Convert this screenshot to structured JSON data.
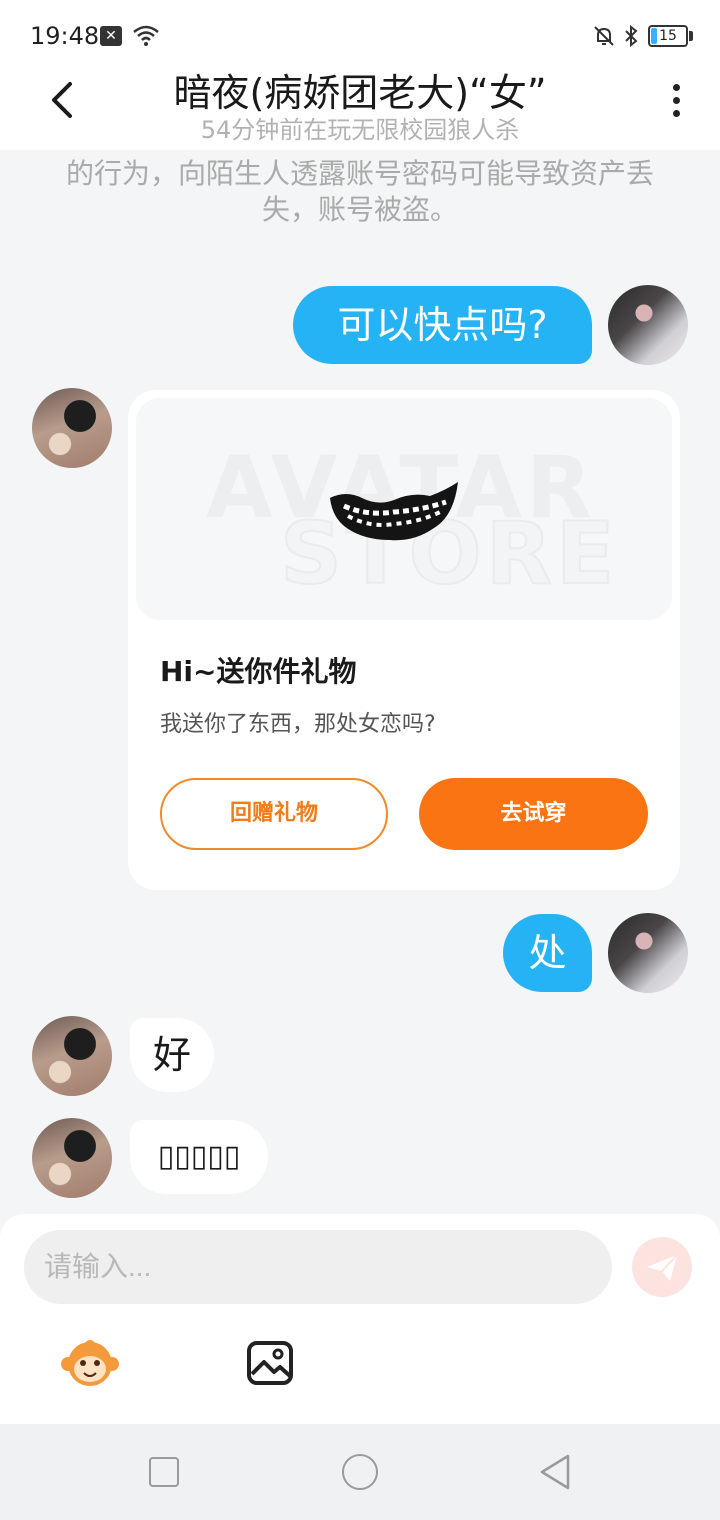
{
  "status_bar": {
    "time": "19:48",
    "battery": "15"
  },
  "header": {
    "title": "暗夜(病娇团老大)“女”",
    "subtitle": "54分钟前在玩无限校园狼人杀"
  },
  "notice": {
    "text": "谨防以买号、代充值、代练等名义索要账号和密码的行为，向陌生人透露账号密码可能导致资产丢失，账号被盗。"
  },
  "messages": [
    {
      "side": "out",
      "text": "可以快点吗?"
    },
    {
      "side": "in",
      "type": "gift"
    },
    {
      "side": "out",
      "text": "处"
    },
    {
      "side": "in",
      "text": "好"
    },
    {
      "side": "in",
      "text": "▯▯▯▯▯"
    }
  ],
  "gift_card": {
    "watermark_line1": "AVATAR",
    "watermark_line2": "STORE",
    "title": "Hi~送你件礼物",
    "description": "我送你了东西，那处女恋吗?",
    "return_gift_label": "回赠礼物",
    "try_on_label": "去试穿"
  },
  "composer": {
    "placeholder": "请输入..."
  },
  "icons": {
    "back": "chevron-left-icon",
    "more": "more-vertical-icon",
    "send": "paper-plane-icon",
    "emoji": "monkey-emoji-icon",
    "image": "image-icon"
  },
  "colors": {
    "outgoing_bubble": "#25b3f5",
    "primary_button": "#fa7413",
    "send_button_bg": "#fde3df"
  }
}
